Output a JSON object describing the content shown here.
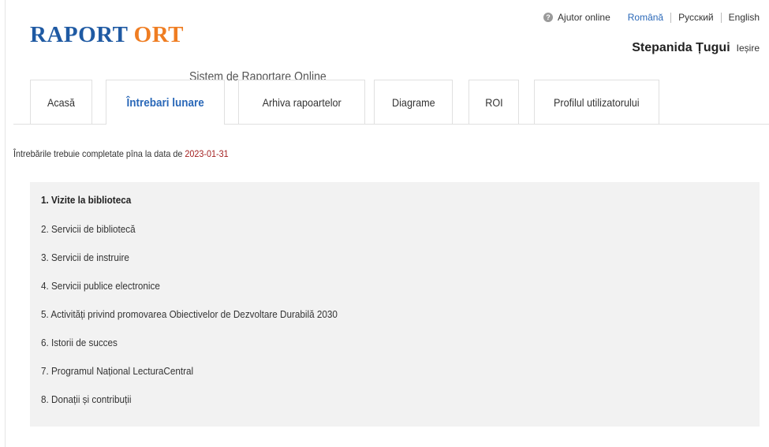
{
  "header": {
    "logo_part1": "RAPORT",
    "logo_part2": "ORT",
    "subtitle": "Sistem de Raportare Online",
    "help_label": "Ajutor online",
    "languages": [
      "Română",
      "Русский",
      "English"
    ],
    "active_language": "Română",
    "user_name": "Stepanida Țugui",
    "logout_label": "Ieșire"
  },
  "tabs": [
    {
      "label": "Acasă"
    },
    {
      "label": "Întrebari lunare"
    },
    {
      "label": "Arhiva rapoartelor"
    },
    {
      "label": "Diagrame"
    },
    {
      "label": "ROI"
    },
    {
      "label": "Profilul utilizatorului"
    }
  ],
  "active_tab": "Întrebari lunare",
  "content": {
    "deadline_text": "Întrebările trebuie completate pîna la data de",
    "deadline_date": "2023-01-31",
    "questions": [
      "1. Vizite la biblioteca",
      "2. Servicii de bibliotecă",
      "3. Servicii de instruire",
      "4. Servicii publice electronice",
      "5. Activități privind promovarea Obiectivelor de Dezvoltare Durabilă 2030",
      "6. Istorii de succes",
      "7. Programul Național LecturaCentral",
      "8. Donații și contribuții"
    ],
    "active_question": "1. Vizite la biblioteca"
  },
  "colors": {
    "logo_blue": "#1f5aa3",
    "logo_orange": "#ef7d22",
    "link_blue": "#2a68b8",
    "date_red": "#a31f1f",
    "panel_bg": "#f2f2f2"
  }
}
